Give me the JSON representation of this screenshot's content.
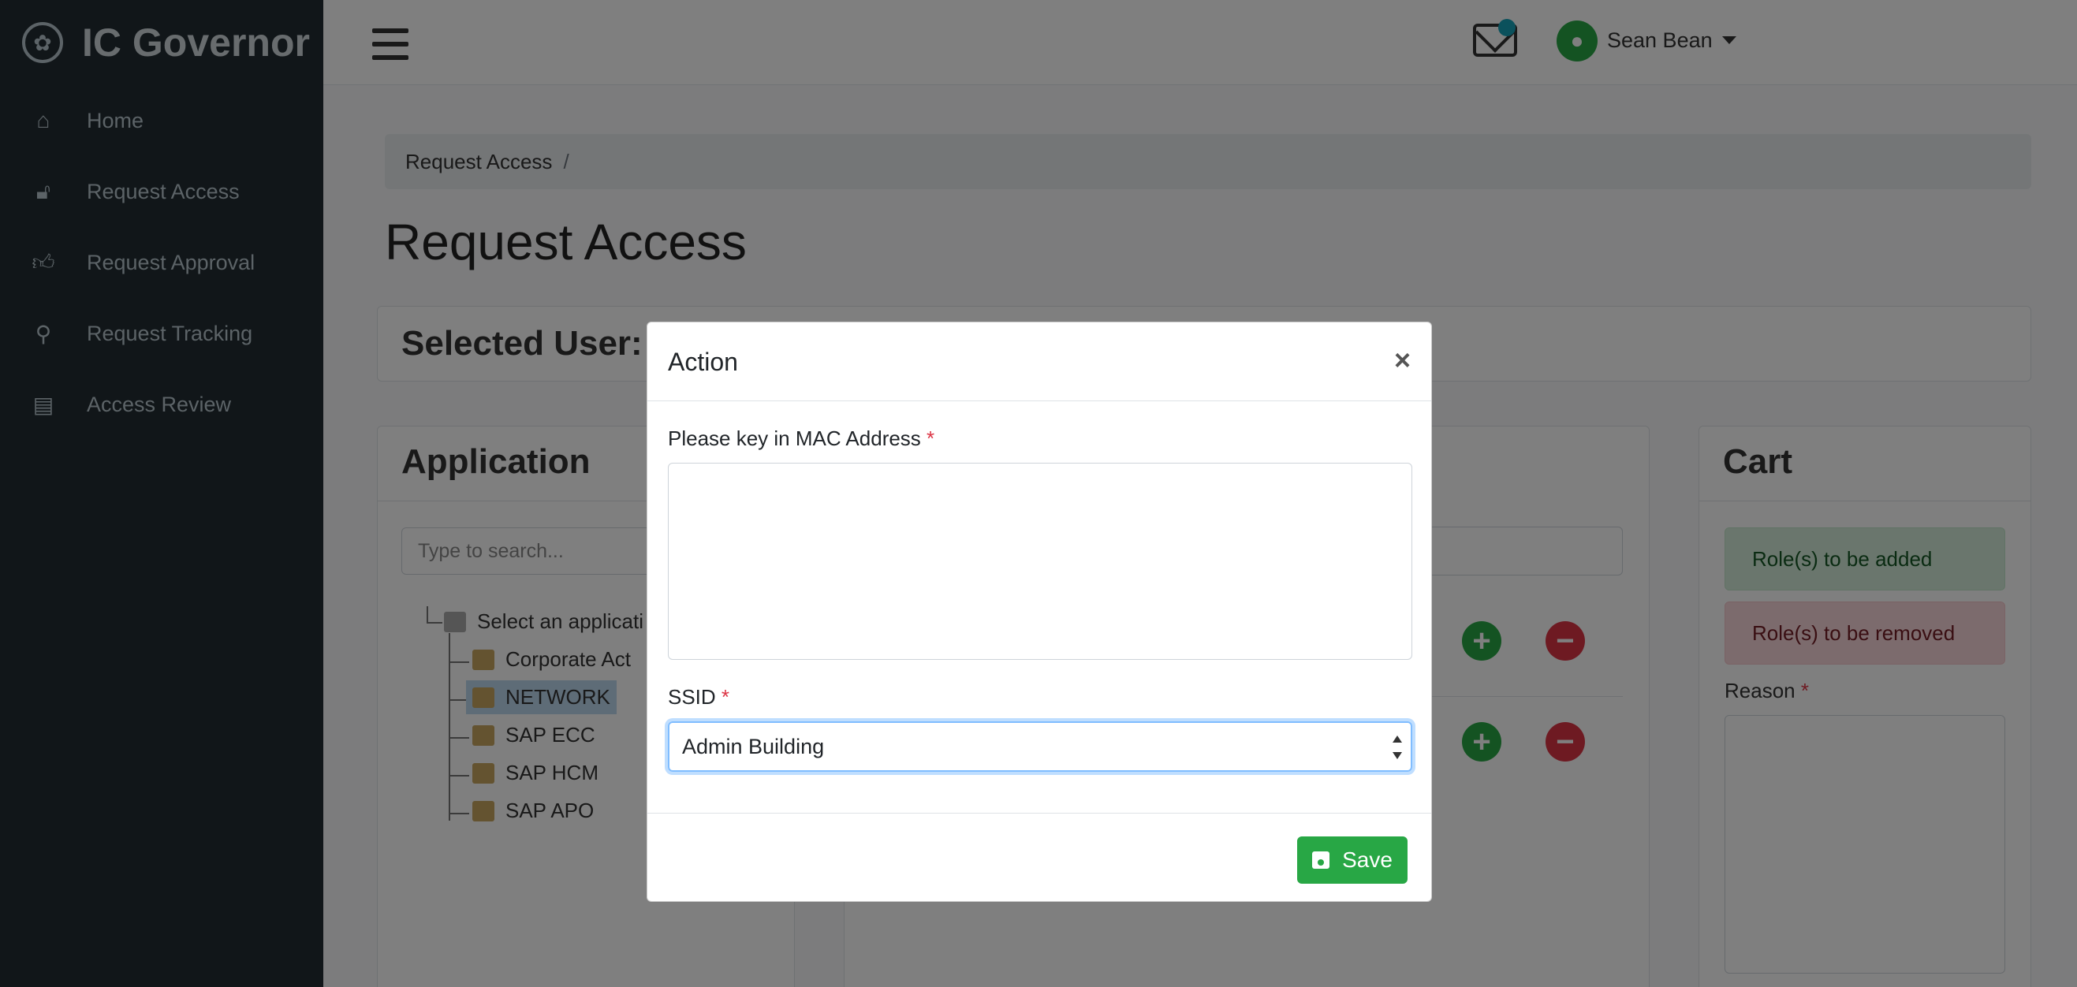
{
  "app": {
    "brand": "IC Governor"
  },
  "sidebar": {
    "items": [
      {
        "label": "Home",
        "icon": "home-icon"
      },
      {
        "label": "Request Access",
        "icon": "unlock-icon"
      },
      {
        "label": "Request Approval",
        "icon": "thumbs-up-icon"
      },
      {
        "label": "Request Tracking",
        "icon": "search-icon"
      },
      {
        "label": "Access Review",
        "icon": "clipboard-icon"
      }
    ]
  },
  "header": {
    "user_name": "Sean Bean"
  },
  "breadcrumb": {
    "item": "Request Access",
    "separator": "/"
  },
  "page": {
    "title": "Request Access",
    "selected_user_label": "Selected User:"
  },
  "application": {
    "title": "Application",
    "search_placeholder": "Type to search...",
    "tree": {
      "root": "Select an applicati",
      "children": [
        "Corporate Act",
        "NETWORK",
        "SAP ECC",
        "SAP HCM",
        "SAP APO"
      ],
      "selected": "NETWORK"
    }
  },
  "cart": {
    "title": "Cart",
    "roles_added": "Role(s) to be added",
    "roles_removed": "Role(s) to be removed",
    "reason_label": "Reason",
    "required_mark": "*"
  },
  "modal": {
    "title": "Action",
    "close": "×",
    "mac_label": "Please key in MAC Address",
    "mac_value": "",
    "ssid_label": "SSID",
    "ssid_value": "Admin Building",
    "required_mark": "*",
    "save_label": "Save"
  },
  "colors": {
    "sidebar_bg": "#222d32",
    "save_green": "#28a745",
    "remove_red": "#dc3545",
    "focus_blue": "#80bdff"
  }
}
